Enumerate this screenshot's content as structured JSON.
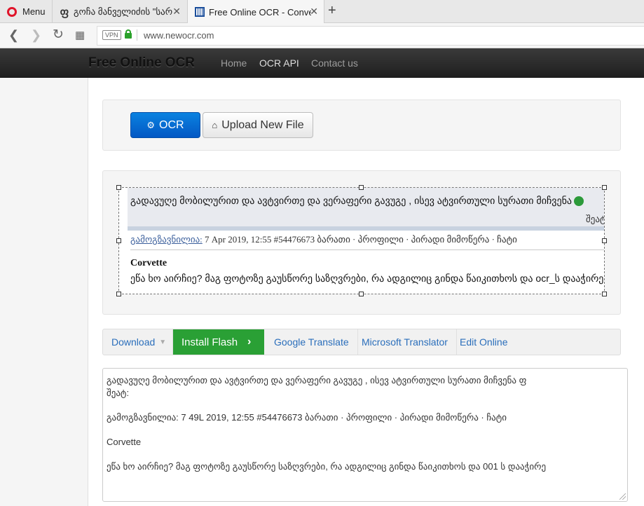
{
  "browser": {
    "menu_label": "Menu",
    "tabs": [
      {
        "title": "გოჩა მანველიძის \"სარ",
        "favicon": "geo-letter-icon"
      },
      {
        "title": "Free Online OCR - Convert",
        "favicon": "grid-icon"
      }
    ],
    "vpn_label": "VPN",
    "url": "www.newocr.com"
  },
  "site": {
    "brand": "Free Online OCR",
    "nav": [
      "Home",
      "OCR API",
      "Contact us"
    ]
  },
  "actions": {
    "ocr_label": "OCR",
    "upload_label": "Upload New File"
  },
  "preview": {
    "line1": "გადავუღე მობილურით და ავტვირთე და ვერაფერი გავუგე , ისევ ატვირთული სურათი მიჩვენა",
    "line2": "შეატ",
    "author_label": "გამოგზავნილია:",
    "meta": " 7 Apr 2019, 12:55  #54476673     ბარათი · პროფილი · პირადი მიმოწერა · ჩატი",
    "name": "Corvette",
    "text": "ეწა ხო აირჩიე? მაგ ფოტოზე გაუსწორე საზღვრები, რა ადგილიც გინდა წაიკითხოს და ocr_ს დააჭირე"
  },
  "toolbar": {
    "download": "Download",
    "install_flash": "Install Flash",
    "google_translate": "Google Translate",
    "microsoft_translator": "Microsoft Translator",
    "edit_online": "Edit Online"
  },
  "result_text": "გადავუღე მობილურით და ავტვირთე და ვერაფერი გავუგე , ისევ ატვირთული სურათი მიჩვენა ფ\nშეატ:\n\nგამოგზავნილია: 7 49L 2019, 12:55 #54476673 ბარათი · პროფილი · პირადი მიმოწერა · ჩატი\n\nCorvette\n\nეწა ხო აირჩიე? მაგ ფოტოზე გაუსწორე საზღვრები, რა ადგილიც გინდა წაიკითხოს და 001 ს დააჭირე",
  "colors": {
    "accent": "#0a6fd6",
    "flash_green": "#2aa035",
    "link": "#2a6ebb",
    "opera_red": "#e0142a"
  }
}
